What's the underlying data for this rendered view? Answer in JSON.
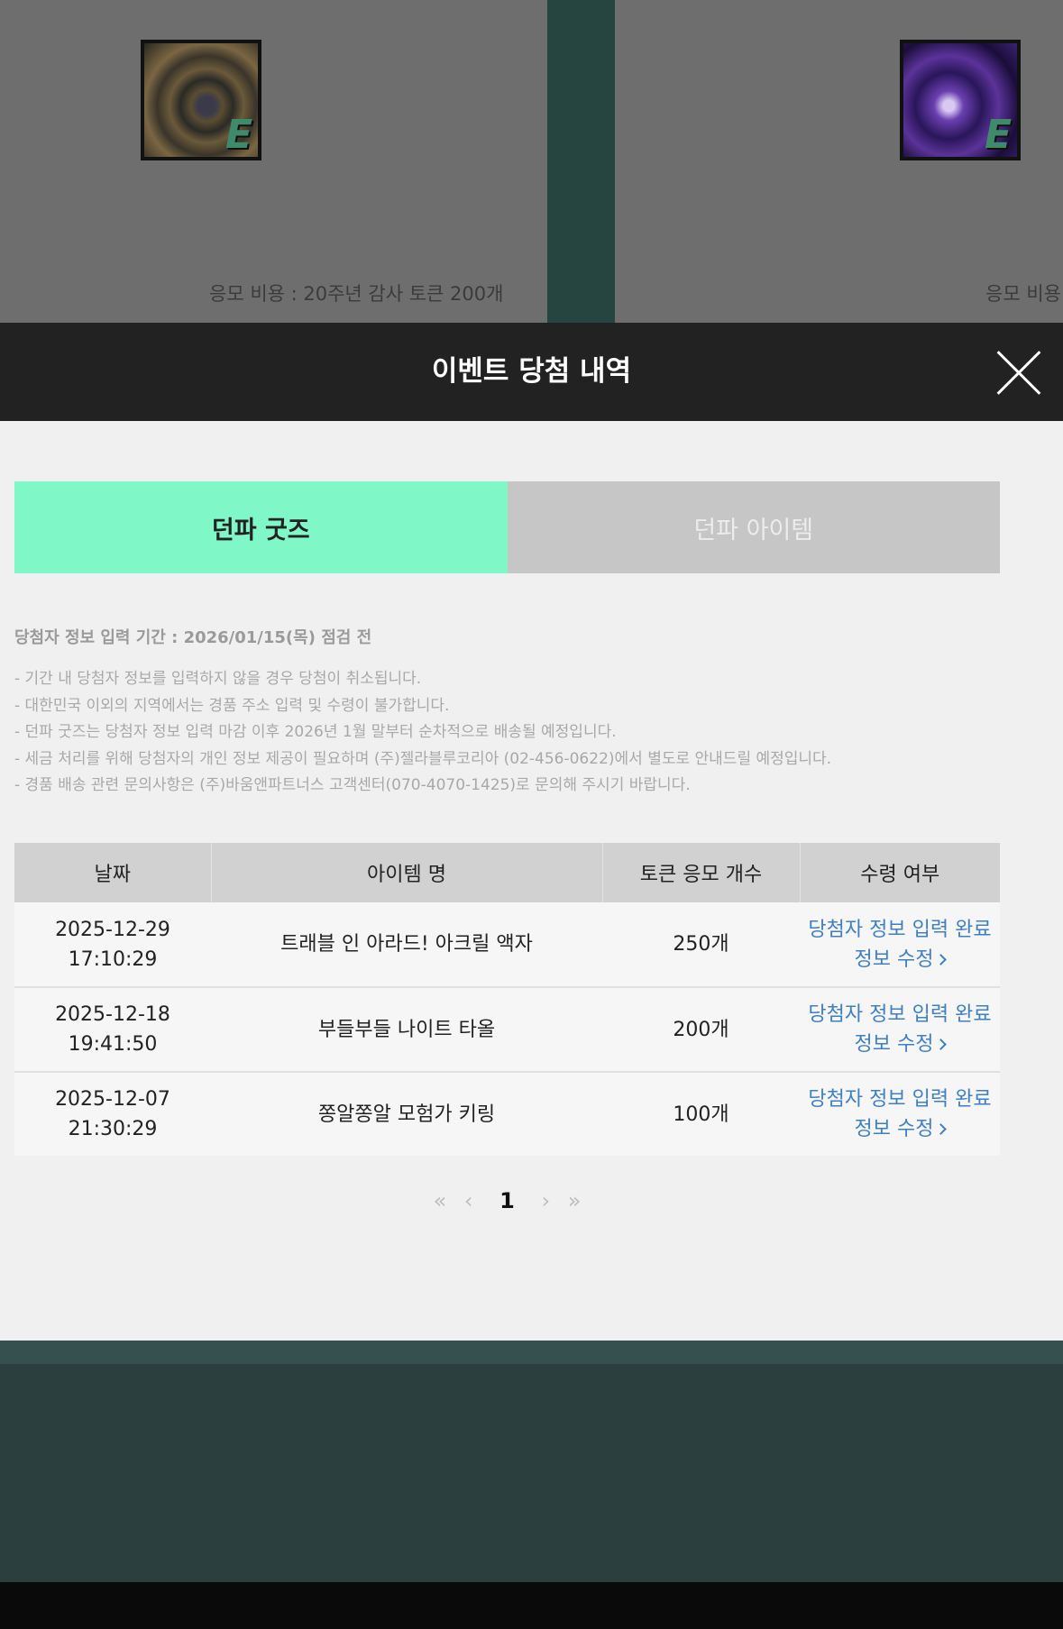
{
  "background": {
    "cost_left": "응모 비용 : 20주년 감사 토큰 200개",
    "cost_right": "응모 비용",
    "icon_left": "sword-item-icon",
    "icon_right": "orb-item-icon",
    "badge_left": "E",
    "badge_right": "E"
  },
  "modal": {
    "title": "이벤트 당첨 내역",
    "close_icon": "close-icon"
  },
  "tabs": [
    {
      "label": "던파 굿즈",
      "active": true
    },
    {
      "label": "던파 아이템",
      "active": false
    }
  ],
  "notice": {
    "title": "당첨자 정보 입력 기간 : 2026/01/15(목) 점검 전",
    "lines": [
      "- 기간 내 당첨자 정보를 입력하지 않을 경우 당첨이 취소됩니다.",
      "- 대한민국 이외의 지역에서는 경품 주소 입력 및 수령이 불가합니다.",
      "- 던파 굿즈는 당첨자 정보 입력 마감 이후 2026년 1월 말부터 순차적으로 배송될 예정입니다.",
      "- 세금 처리를 위해 당첨자의 개인 정보 제공이 필요하며 (주)젤라블루코리아 (02-456-0622)에서 별도로 안내드릴 예정입니다.",
      "- 경품 배송 관련 문의사항은 (주)바움앤파트너스 고객센터(070-4070-1425)로 문의해 주시기 바랍니다."
    ]
  },
  "table": {
    "headers": [
      "날짜",
      "아이템 명",
      "토큰 응모 개수",
      "수령 여부"
    ],
    "rows": [
      {
        "date": "2025-12-29",
        "time": "17:10:29",
        "item": "트래블 인 아라드! 아크릴 액자",
        "tokens": "250개",
        "status": "당첨자 정보 입력 완료",
        "action": "정보 수정"
      },
      {
        "date": "2025-12-18",
        "time": "19:41:50",
        "item": "부들부들 나이트 타올",
        "tokens": "200개",
        "status": "당첨자 정보 입력 완료",
        "action": "정보 수정"
      },
      {
        "date": "2025-12-07",
        "time": "21:30:29",
        "item": "쫑알쫑알 모험가 키링",
        "tokens": "100개",
        "status": "당첨자 정보 입력 완료",
        "action": "정보 수정"
      }
    ]
  },
  "pagination": {
    "first": "«",
    "prev": "‹",
    "current": "1",
    "next": "›",
    "last": "»"
  },
  "colors": {
    "active_tab": "#7ff7c6",
    "status_link": "#3f7fc2",
    "header_bg": "#222222"
  }
}
